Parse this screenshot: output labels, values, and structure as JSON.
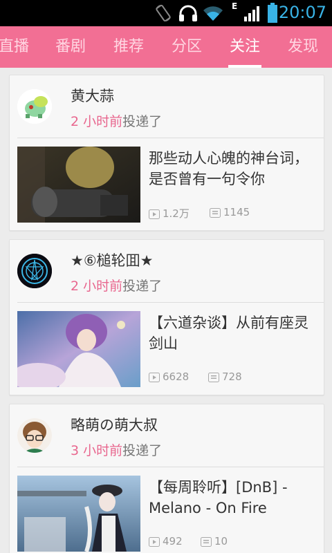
{
  "status_bar": {
    "network_label": "E",
    "time": "20:07"
  },
  "tabs": [
    {
      "label": "直播"
    },
    {
      "label": "番剧"
    },
    {
      "label": "推荐"
    },
    {
      "label": "分区"
    },
    {
      "label": "关注",
      "active": true
    },
    {
      "label": "发现"
    }
  ],
  "feed": [
    {
      "username": "黄大蒜",
      "time_ago": "2 小时前",
      "action": "投递了",
      "video_title": "那些动人心魄的神台词，是否曾有一句令你",
      "plays": "1.2万",
      "comments": "1145"
    },
    {
      "username": "★⑥槌轮囬★",
      "time_ago": "2 小时前",
      "action": "投递了",
      "video_title": "【六道杂谈】从前有座灵剑山",
      "plays": "6628",
      "comments": "728"
    },
    {
      "username": "略萌の萌大叔",
      "time_ago": "3 小时前",
      "action": "投递了",
      "video_title": "【每周聆听】[DnB] - Melano - On Fire",
      "plays": "492",
      "comments": "10"
    }
  ],
  "colors": {
    "accent": "#f26f94",
    "time_highlight": "#e8668e",
    "status_icon": "#39b3e6"
  },
  "icons": {
    "play_count": "play-icon",
    "comment_count": "comment-icon"
  }
}
